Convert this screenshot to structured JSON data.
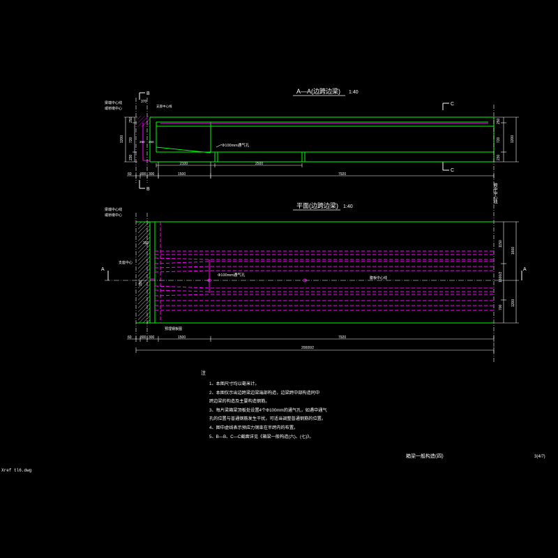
{
  "section_view": {
    "title": "A—A(边跨边梁)",
    "scale": "1:40",
    "left_label_1": "梁端中心线",
    "left_label_2": "或桥墩中心",
    "bearing_label": "支座中心线",
    "cut_b": "B",
    "cut_c": "C",
    "dim_top": "370",
    "dim_left_total": "1200",
    "dim_left_a": "250",
    "dim_left_b": "720",
    "dim_left_c": "230",
    "dim_mid_a": "250",
    "dim_mid_b": "250",
    "dim_right_a": "250",
    "dim_right_b": "720",
    "dim_right_c": "230",
    "dim_right_total": "1200",
    "vent_label": "Φ100mm通气孔",
    "dim_span_a": "2100",
    "dim_span_b": "2500",
    "dim_row": [
      "60",
      "300",
      "300",
      "1500",
      "7920"
    ]
  },
  "plan_view": {
    "title": "平面(边跨边梁)",
    "scale": "1:40",
    "left_label_1": "梁端中心线",
    "left_label_2": "或桥墩中心",
    "bearing_label": "支座中心",
    "bottom_label": "预埋钢板图",
    "vert_label": "跨中中心线",
    "dim_left_a": "350",
    "dim_left_b": "350",
    "vent_label": "Φ100mm通气孔",
    "centerline_label": "腹板中心线",
    "dim_right_a": "1150",
    "dim_right_b": "1600/2",
    "dim_right_c": "700",
    "dim_right_outer_a": "1600",
    "dim_right_outer_b": "1200",
    "cut_a": "A",
    "dim_row": [
      "60",
      "300",
      "300",
      "1500",
      "7920"
    ],
    "dim_total": "20000/2"
  },
  "notes": {
    "heading": "注",
    "lines": [
      "1、本图尺寸均以毫米计。",
      "2、本图仅示出边跨梁边梁端部构造，边梁跨中部构造同中",
      "   跨边梁的构造及主要构造钢筋。",
      "3、每片梁箱梁顶板处设置4个Φ100mm的通气孔，如遇中通气",
      "   孔的位置与普通钢筋发生干扰，可适当调整普通钢筋的位置。",
      "4、图中虚线表示预应力钢束在半跨内的布置。",
      "5、B—B、C—C截面详见《箱梁一般构造(六)、(七)》。"
    ]
  },
  "title_block": {
    "drawing_title": "箱梁一般构造(四)",
    "sheet": "3(4/7)"
  },
  "xref": "Xref tl6.dwg",
  "colors": {
    "outline": "#00ff00",
    "tendon": "#ff00ff",
    "text": "#ffffff",
    "dim": "#ffffff",
    "centerline": "#ffffff"
  }
}
